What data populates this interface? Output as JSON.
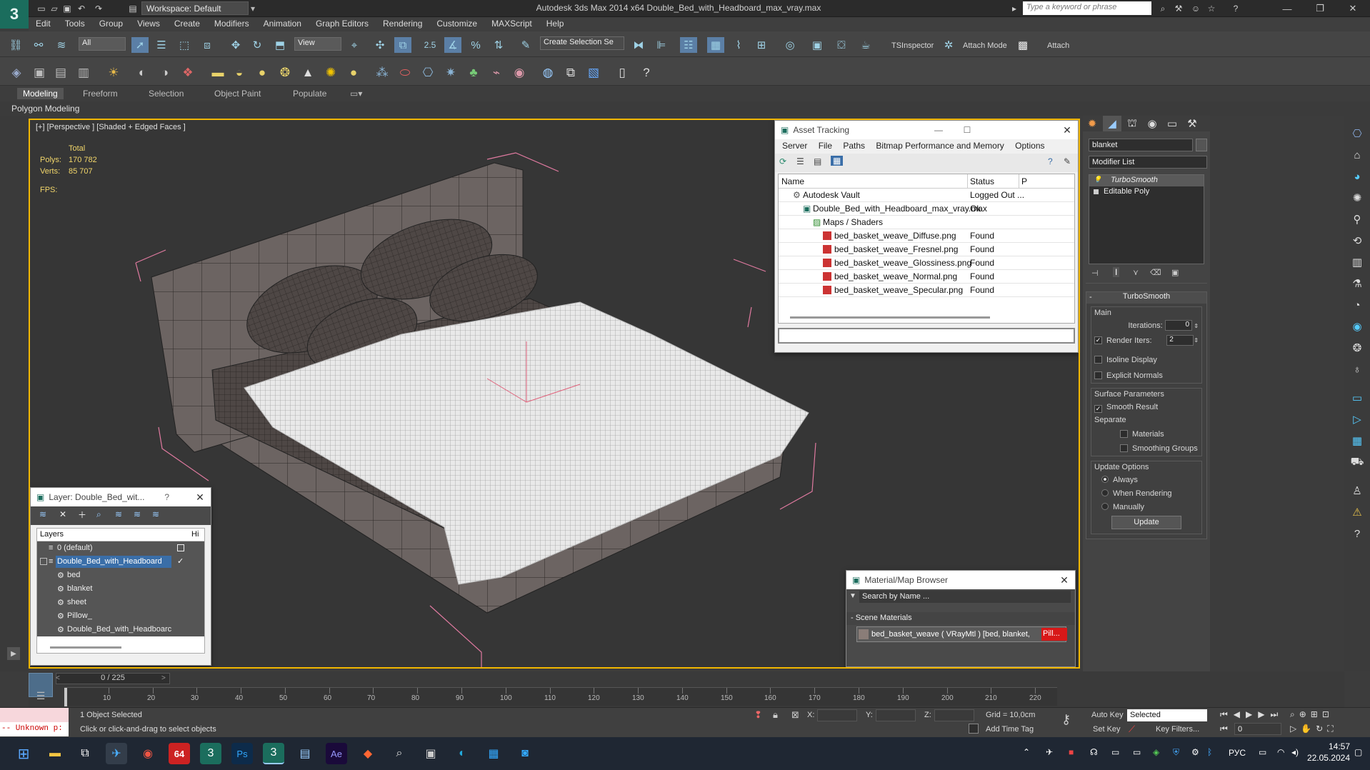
{
  "app": {
    "logo": "3",
    "title": "Autodesk 3ds Max  2014 x64    Double_Bed_with_Headboard_max_vray.max",
    "workspace": "Workspace: Default",
    "search_placeholder": "Type a keyword or phrase"
  },
  "menu": [
    "Edit",
    "Tools",
    "Group",
    "Views",
    "Create",
    "Modifiers",
    "Animation",
    "Graph Editors",
    "Rendering",
    "Customize",
    "MAXScript",
    "Help"
  ],
  "toolbar": {
    "selection_filter": "All",
    "ref_coord": "View",
    "snap_value": "2.5",
    "named_selection": "Create Selection Se",
    "tsinspector": "TSInspector",
    "attach_mode": "Attach Mode",
    "attach": "Attach"
  },
  "ribbon": {
    "tabs": [
      "Modeling",
      "Freeform",
      "Selection",
      "Object Paint",
      "Populate"
    ],
    "sub": "Polygon Modeling"
  },
  "viewport": {
    "label": "[+] [Perspective ] [Shaded + Edged Faces ]",
    "total_label": "Total",
    "polys_label": "Polys:",
    "polys": "170 782",
    "verts_label": "Verts:",
    "verts": "85 707",
    "fps_label": "FPS:"
  },
  "asset_tracking": {
    "title": "Asset Tracking",
    "menu": [
      "Server",
      "File",
      "Paths",
      "Bitmap Performance and Memory",
      "Options"
    ],
    "col_name": "Name",
    "col_status": "Status",
    "col_p": "P",
    "rows": [
      {
        "name": "Autodesk Vault",
        "status": "Logged Out ..."
      },
      {
        "name": "Double_Bed_with_Headboard_max_vray.max",
        "status": "Ok"
      },
      {
        "name": "Maps / Shaders",
        "status": ""
      },
      {
        "name": "bed_basket_weave_Diffuse.png",
        "status": "Found"
      },
      {
        "name": "bed_basket_weave_Fresnel.png",
        "status": "Found"
      },
      {
        "name": "bed_basket_weave_Glossiness.png",
        "status": "Found"
      },
      {
        "name": "bed_basket_weave_Normal.png",
        "status": "Found"
      },
      {
        "name": "bed_basket_weave_Specular.png",
        "status": "Found"
      }
    ]
  },
  "layer": {
    "title": "Layer: Double_Bed_wit...",
    "help": "?",
    "col_layers": "Layers",
    "col_hide": "Hi",
    "rows": [
      "0 (default)",
      "Double_Bed_with_Headboard",
      "bed",
      "blanket",
      "sheet",
      "Pillow_",
      "Double_Bed_with_Headboarc"
    ]
  },
  "material_browser": {
    "title": "Material/Map Browser",
    "search_placeholder": "Search by Name ...",
    "section": "- Scene Materials",
    "item": "bed_basket_weave  ( VRayMtl )  [bed, blanket, ",
    "item_red": "Pill..."
  },
  "panel": {
    "object_name": "blanket",
    "modifier_list": "Modifier List",
    "stack": [
      "TurboSmooth",
      "Editable Poly"
    ],
    "rollout_title": "TurboSmooth",
    "main": "Main",
    "iterations_label": "Iterations:",
    "iterations": "0",
    "render_iters_label": "Render Iters:",
    "render_iters": "2",
    "isoline": "Isoline Display",
    "explicit_normals": "Explicit Normals",
    "surface_params": "Surface Parameters",
    "smooth_result": "Smooth Result",
    "separate": "Separate",
    "materials": "Materials",
    "smoothing_groups": "Smoothing Groups",
    "update_options": "Update Options",
    "always": "Always",
    "when_rendering": "When Rendering",
    "manually": "Manually",
    "update": "Update"
  },
  "timeline": {
    "frame": "0 / 225",
    "ticks": [
      "10",
      "20",
      "30",
      "40",
      "50",
      "60",
      "70",
      "80",
      "90",
      "100",
      "110",
      "120",
      "130",
      "140",
      "150",
      "160",
      "170",
      "180",
      "190",
      "200",
      "210",
      "220"
    ]
  },
  "status": {
    "maxscript": "-- Unknown p:",
    "selected": "1 Object Selected",
    "prompt": "Click or click-and-drag to select objects",
    "x": "X:",
    "y": "Y:",
    "z": "Z:",
    "grid": "Grid = 10,0cm",
    "add_time_tag": "Add Time Tag",
    "auto_key": "Auto Key",
    "auto_key_mode": "Selected",
    "set_key": "Set Key",
    "key_filters": "Key Filters...",
    "frame_field": "0"
  },
  "taskbar": {
    "lang": "РУС",
    "time": "14:57",
    "date": "22.05.2024",
    "badge": "64"
  }
}
